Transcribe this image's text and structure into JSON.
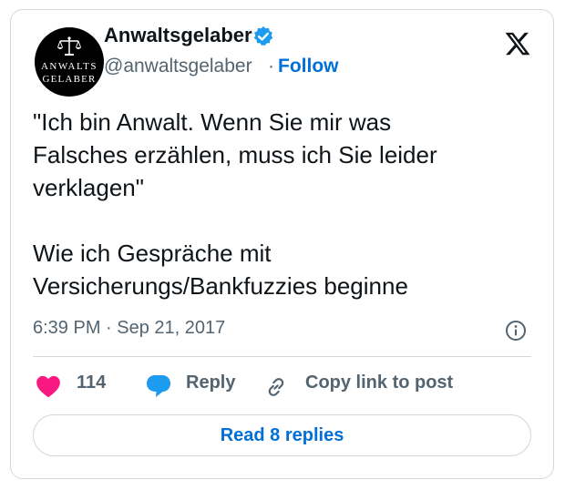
{
  "author": {
    "name": "Anwaltsgelaber",
    "handle": "@anwaltsgelaber",
    "separator": "·",
    "follow_label": "Follow",
    "avatar_text_line1": "ANWALTS",
    "avatar_text_line2": "GELABER",
    "verified": true
  },
  "tweet": {
    "lines": [
      "\"Ich bin Anwalt. Wenn Sie mir was",
      "Falsches erzählen, muss ich Sie leider",
      "verklagen\"",
      "Wie ich Gespräche mit",
      "Versicherungs/Bankfuzzies beginne"
    ],
    "timestamp": "6:39 PM · Sep 21, 2017"
  },
  "actions": {
    "like_count": "114",
    "reply_label": "Reply",
    "copy_label": "Copy link to post"
  },
  "read_replies_label": "Read 8 replies",
  "icons": {
    "logo": "x-logo-icon",
    "verified": "verified-badge-icon",
    "info": "info-icon",
    "like": "heart-icon",
    "reply": "speech-bubble-icon",
    "copy": "link-icon"
  },
  "colors": {
    "accent": "#006fd6",
    "heart": "#f91880",
    "reply_bubble": "#1d9bf0",
    "verified": "#1d9bf0",
    "muted_text": "#536471",
    "border": "#cfd9de"
  }
}
